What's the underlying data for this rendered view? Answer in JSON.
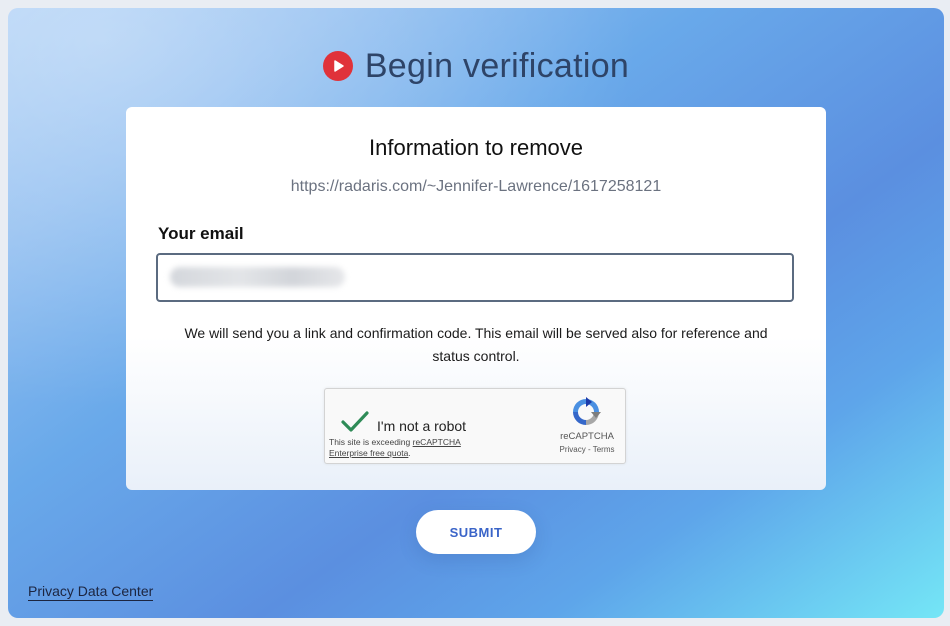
{
  "header": {
    "title": "Begin verification",
    "logo_icon": "play-circle-icon"
  },
  "card": {
    "title": "Information to remove",
    "url": "https://radaris.com/~Jennifer-Lawrence/1617258121",
    "email_label": "Your email",
    "email_value": "",
    "notice": "We will send you a link and confirmation code. This email will be served also for reference and status control."
  },
  "captcha": {
    "label": "I'm not a robot",
    "warning_prefix": "This site is exceeding ",
    "warning_link": "reCAPTCHA Enterprise free quota",
    "warning_suffix": ".",
    "brand": "reCAPTCHA",
    "privacy": "Privacy",
    "separator": " - ",
    "terms": "Terms",
    "checked": true
  },
  "actions": {
    "submit_label": "SUBMIT"
  },
  "footer": {
    "privacy_link": "Privacy Data Center"
  },
  "colors": {
    "accent": "#3a64c8",
    "logo": "#e0323a",
    "title": "#2e4468",
    "check": "#2e8b57"
  }
}
